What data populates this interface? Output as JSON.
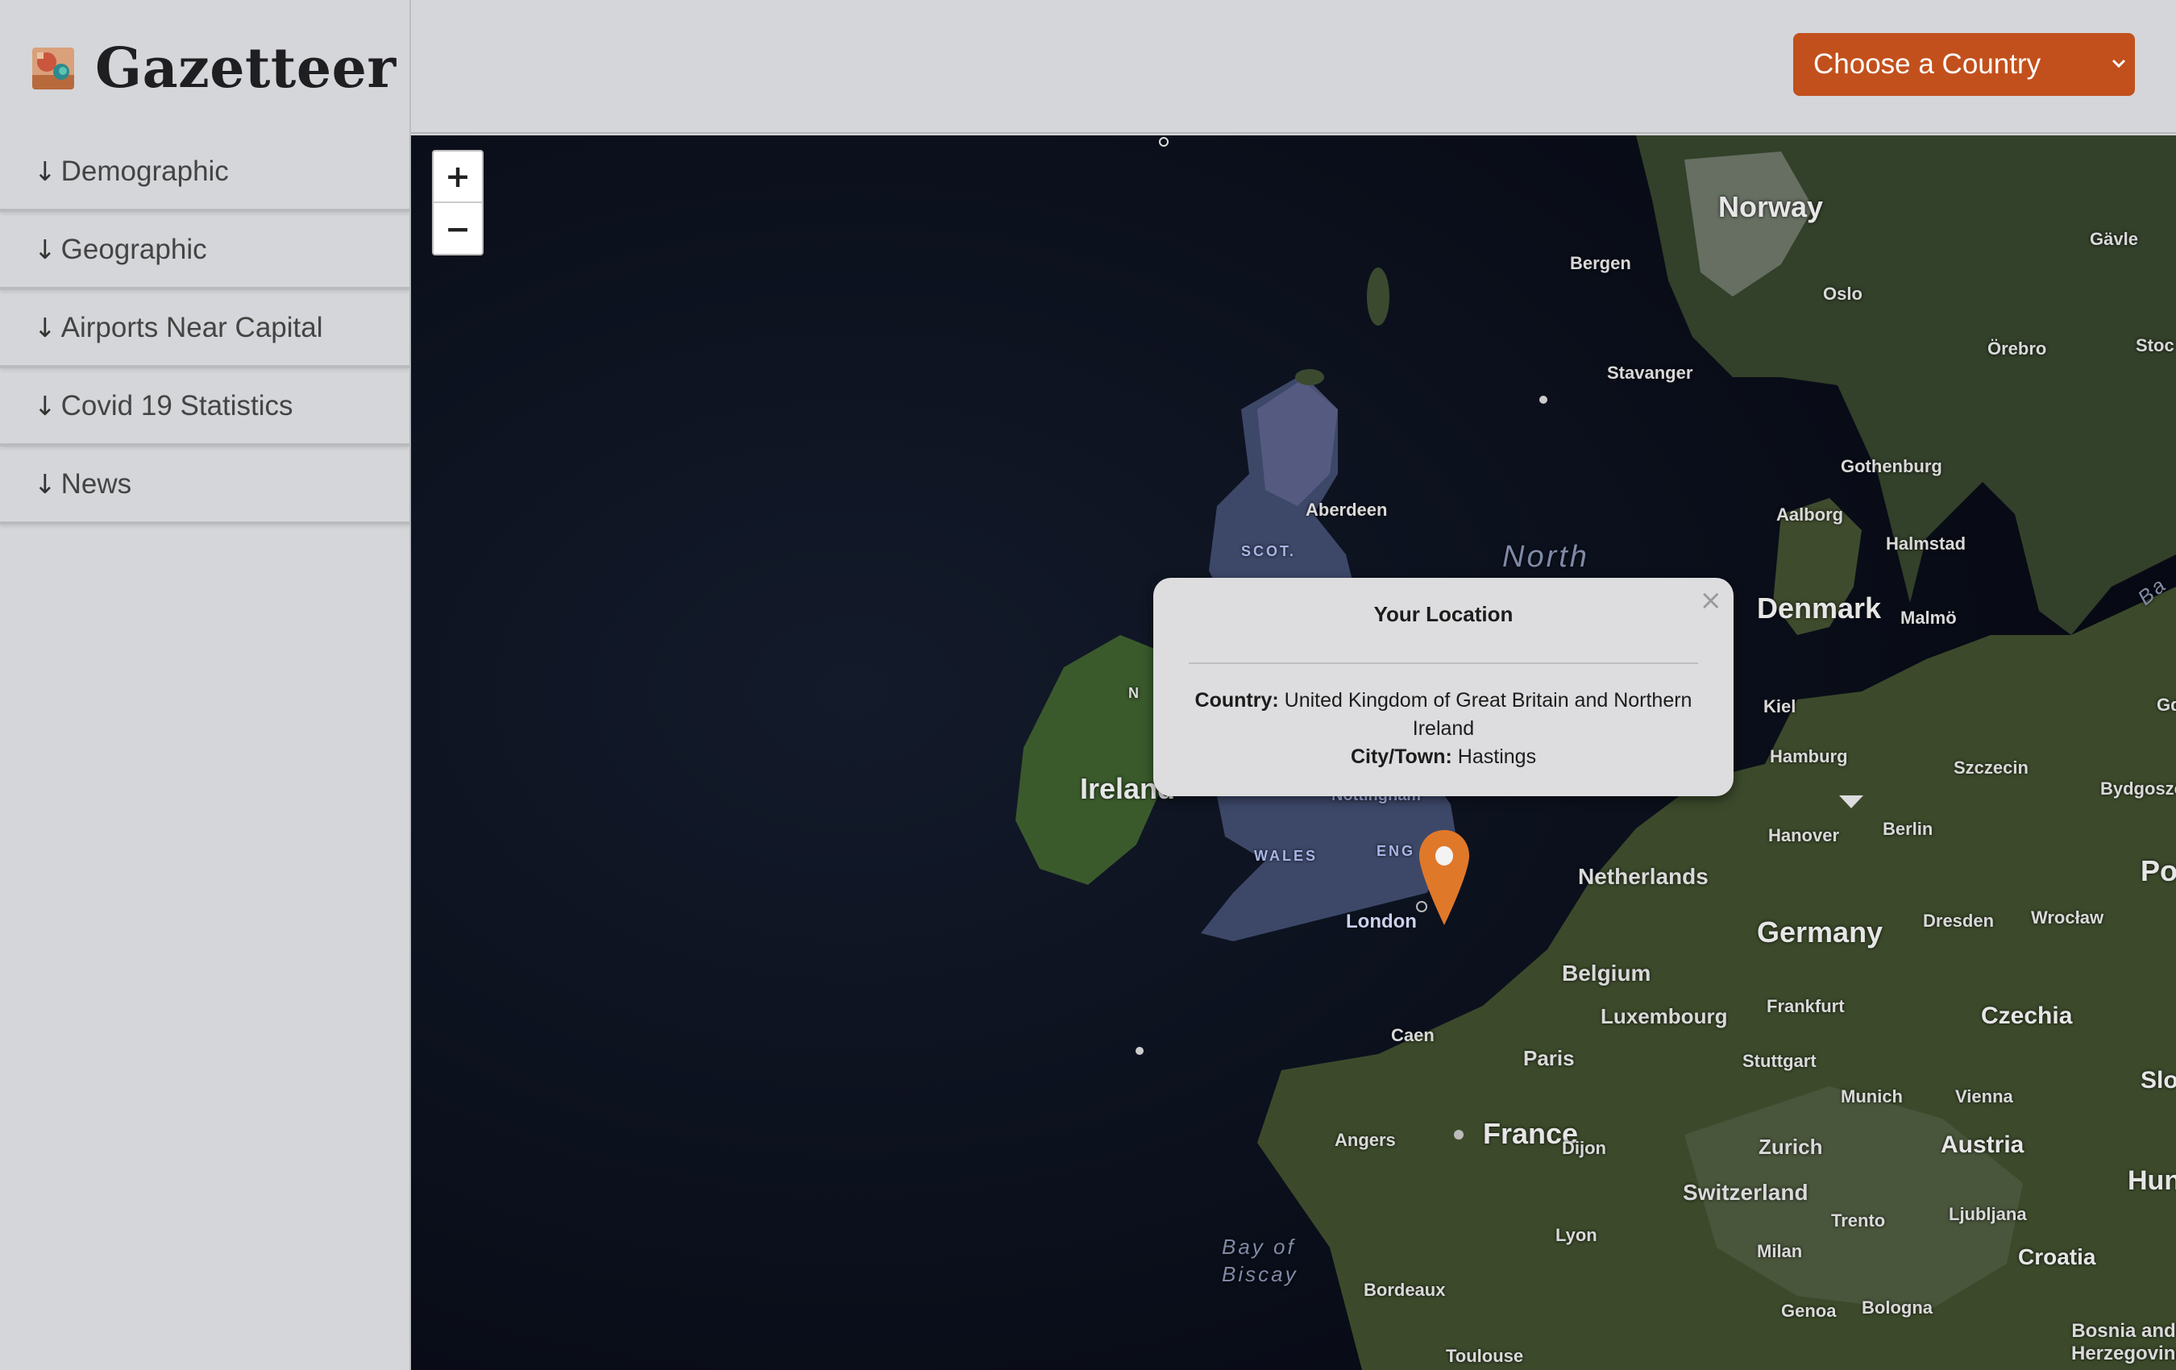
{
  "app": {
    "title": "Gazetteer"
  },
  "sidebar": {
    "items": [
      {
        "label": "Demographic"
      },
      {
        "label": "Geographic"
      },
      {
        "label": "Airports Near Capital"
      },
      {
        "label": "Covid 19 Statistics"
      },
      {
        "label": "News"
      }
    ],
    "arrow_glyph": "↓"
  },
  "header": {
    "country_select": {
      "selected": "Choose a Country"
    }
  },
  "map": {
    "zoom": {
      "in": "+",
      "out": "−"
    },
    "labels": {
      "norway": "Norway",
      "bergen": "Bergen",
      "oslo": "Oslo",
      "stavanger": "Stavanger",
      "gavle": "Gävle",
      "orebro": "Örebro",
      "stoc": "Stoc",
      "gothenburg": "Gothenburg",
      "aalborg": "Aalborg",
      "halmstad": "Halmstad",
      "denmark": "Denmark",
      "malmo": "Malmö",
      "kiel": "Kiel",
      "gdansk": "Gdansk",
      "hamburg": "Hamburg",
      "szczecin": "Szczecin",
      "bydgoszcz": "Bydgoszcz",
      "hanover": "Hanover",
      "berlin": "Berlin",
      "pol": "Pol",
      "netherlands": "Netherlands",
      "germany": "Germany",
      "dresden": "Dresden",
      "wroclaw": "Wrocław",
      "belgium": "Belgium",
      "luxembourg": "Luxembourg",
      "frankfurt": "Frankfurt",
      "czechia": "Czechia",
      "stuttgart": "Stuttgart",
      "paris": "Paris",
      "munich": "Munich",
      "vienna": "Vienna",
      "slo": "Slo",
      "caen": "Caen",
      "france": "France",
      "dijon": "Dijon",
      "zurich": "Zurich",
      "austria": "Austria",
      "angers": "Angers",
      "switzerland": "Switzerland",
      "trento": "Trento",
      "ljubljana": "Ljubljana",
      "hun": "Hun",
      "lyon": "Lyon",
      "milan": "Milan",
      "croatia": "Croatia",
      "bordeaux": "Bordeaux",
      "genoa": "Genoa",
      "bologna": "Bologna",
      "bosnia": "Bosnia and Herzegovina",
      "toulouse": "Toulouse",
      "ireland": "Ireland",
      "wales": "WALES",
      "eng": "ENG",
      "london": "London",
      "nottingham": "Nottingham",
      "scot": "SCOT.",
      "aberdeen": "Aberdeen",
      "n": "N",
      "north": "North",
      "bay": "Bay of",
      "biscay": "Biscay",
      "bal": "Ba"
    }
  },
  "popup": {
    "title": "Your Location",
    "close": "×",
    "country_label": "Country:",
    "country_value": "United Kingdom of Great Britain and Northern Ireland",
    "city_label": "City/Town:",
    "city_value": "Hastings"
  },
  "colors": {
    "accent": "#c2501c",
    "marker": "#e0782a",
    "sidebar_bg": "#d5d6d9",
    "map_sea": "#0b0f1c",
    "land": "#3d4a2c",
    "uk": "#3d4869"
  }
}
